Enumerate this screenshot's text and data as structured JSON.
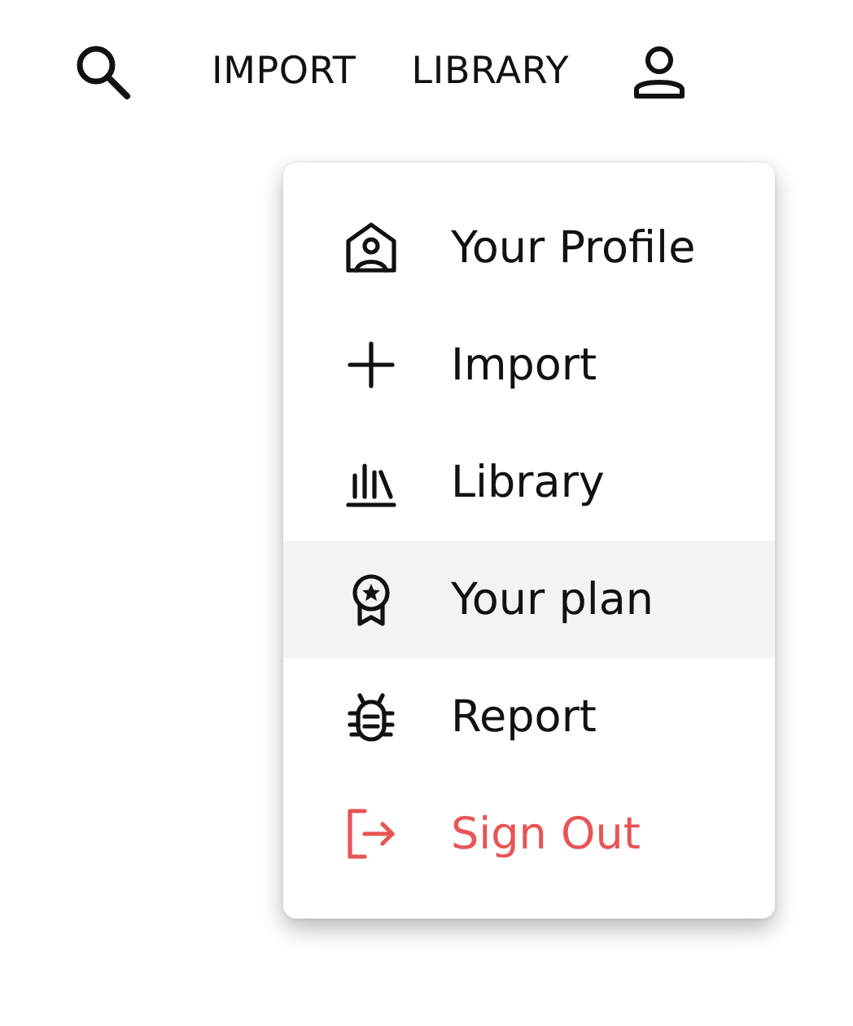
{
  "nav": {
    "links": [
      {
        "label": "IMPORT"
      },
      {
        "label": "LIBRARY"
      }
    ]
  },
  "menu": {
    "items": [
      {
        "label": "Your Profile",
        "kind": "item",
        "selected": false
      },
      {
        "label": "Import",
        "kind": "item",
        "selected": false
      },
      {
        "label": "Library",
        "kind": "item",
        "selected": false
      },
      {
        "label": "Your plan",
        "kind": "item",
        "selected": true
      },
      {
        "label": "Report",
        "kind": "item",
        "selected": false
      },
      {
        "label": "Sign Out",
        "kind": "danger",
        "selected": false
      }
    ]
  }
}
